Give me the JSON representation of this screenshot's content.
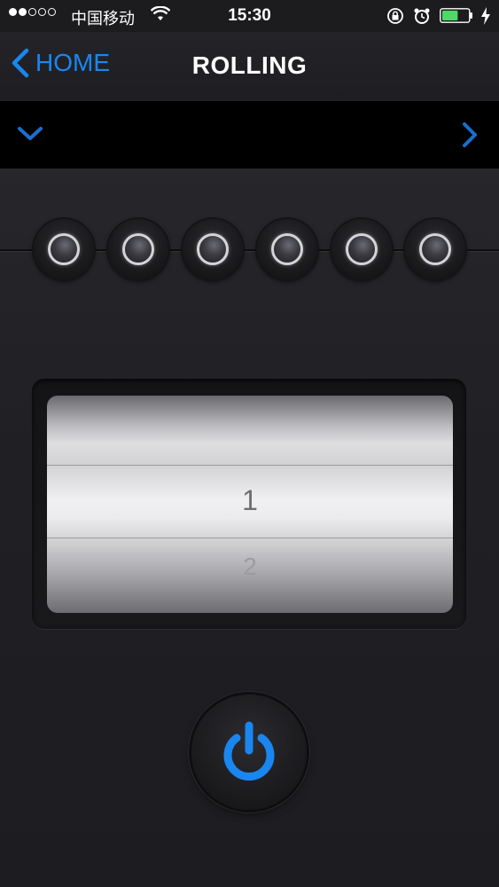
{
  "status_bar": {
    "carrier": "中国移动",
    "time": "15:30",
    "signal_bars_filled": 2,
    "signal_bars_total": 5,
    "battery_level_fraction": 0.6,
    "battery_color": "#4cd964"
  },
  "nav": {
    "back_label": "HOME",
    "title": "ROLLING",
    "accent_color": "#1a86f0"
  },
  "selector": {
    "toggle_icon": "chevron-down-icon",
    "next_icon": "chevron-right-icon"
  },
  "leds": [
    {
      "name": "led-indicator-1"
    },
    {
      "name": "led-indicator-2"
    },
    {
      "name": "led-indicator-3"
    },
    {
      "name": "led-indicator-4"
    },
    {
      "name": "led-indicator-5"
    },
    {
      "name": "led-indicator-6"
    }
  ],
  "picker": {
    "current_value": "1",
    "next_value": "2"
  },
  "power": {
    "icon": "power-icon",
    "color": "#1a86f0"
  }
}
